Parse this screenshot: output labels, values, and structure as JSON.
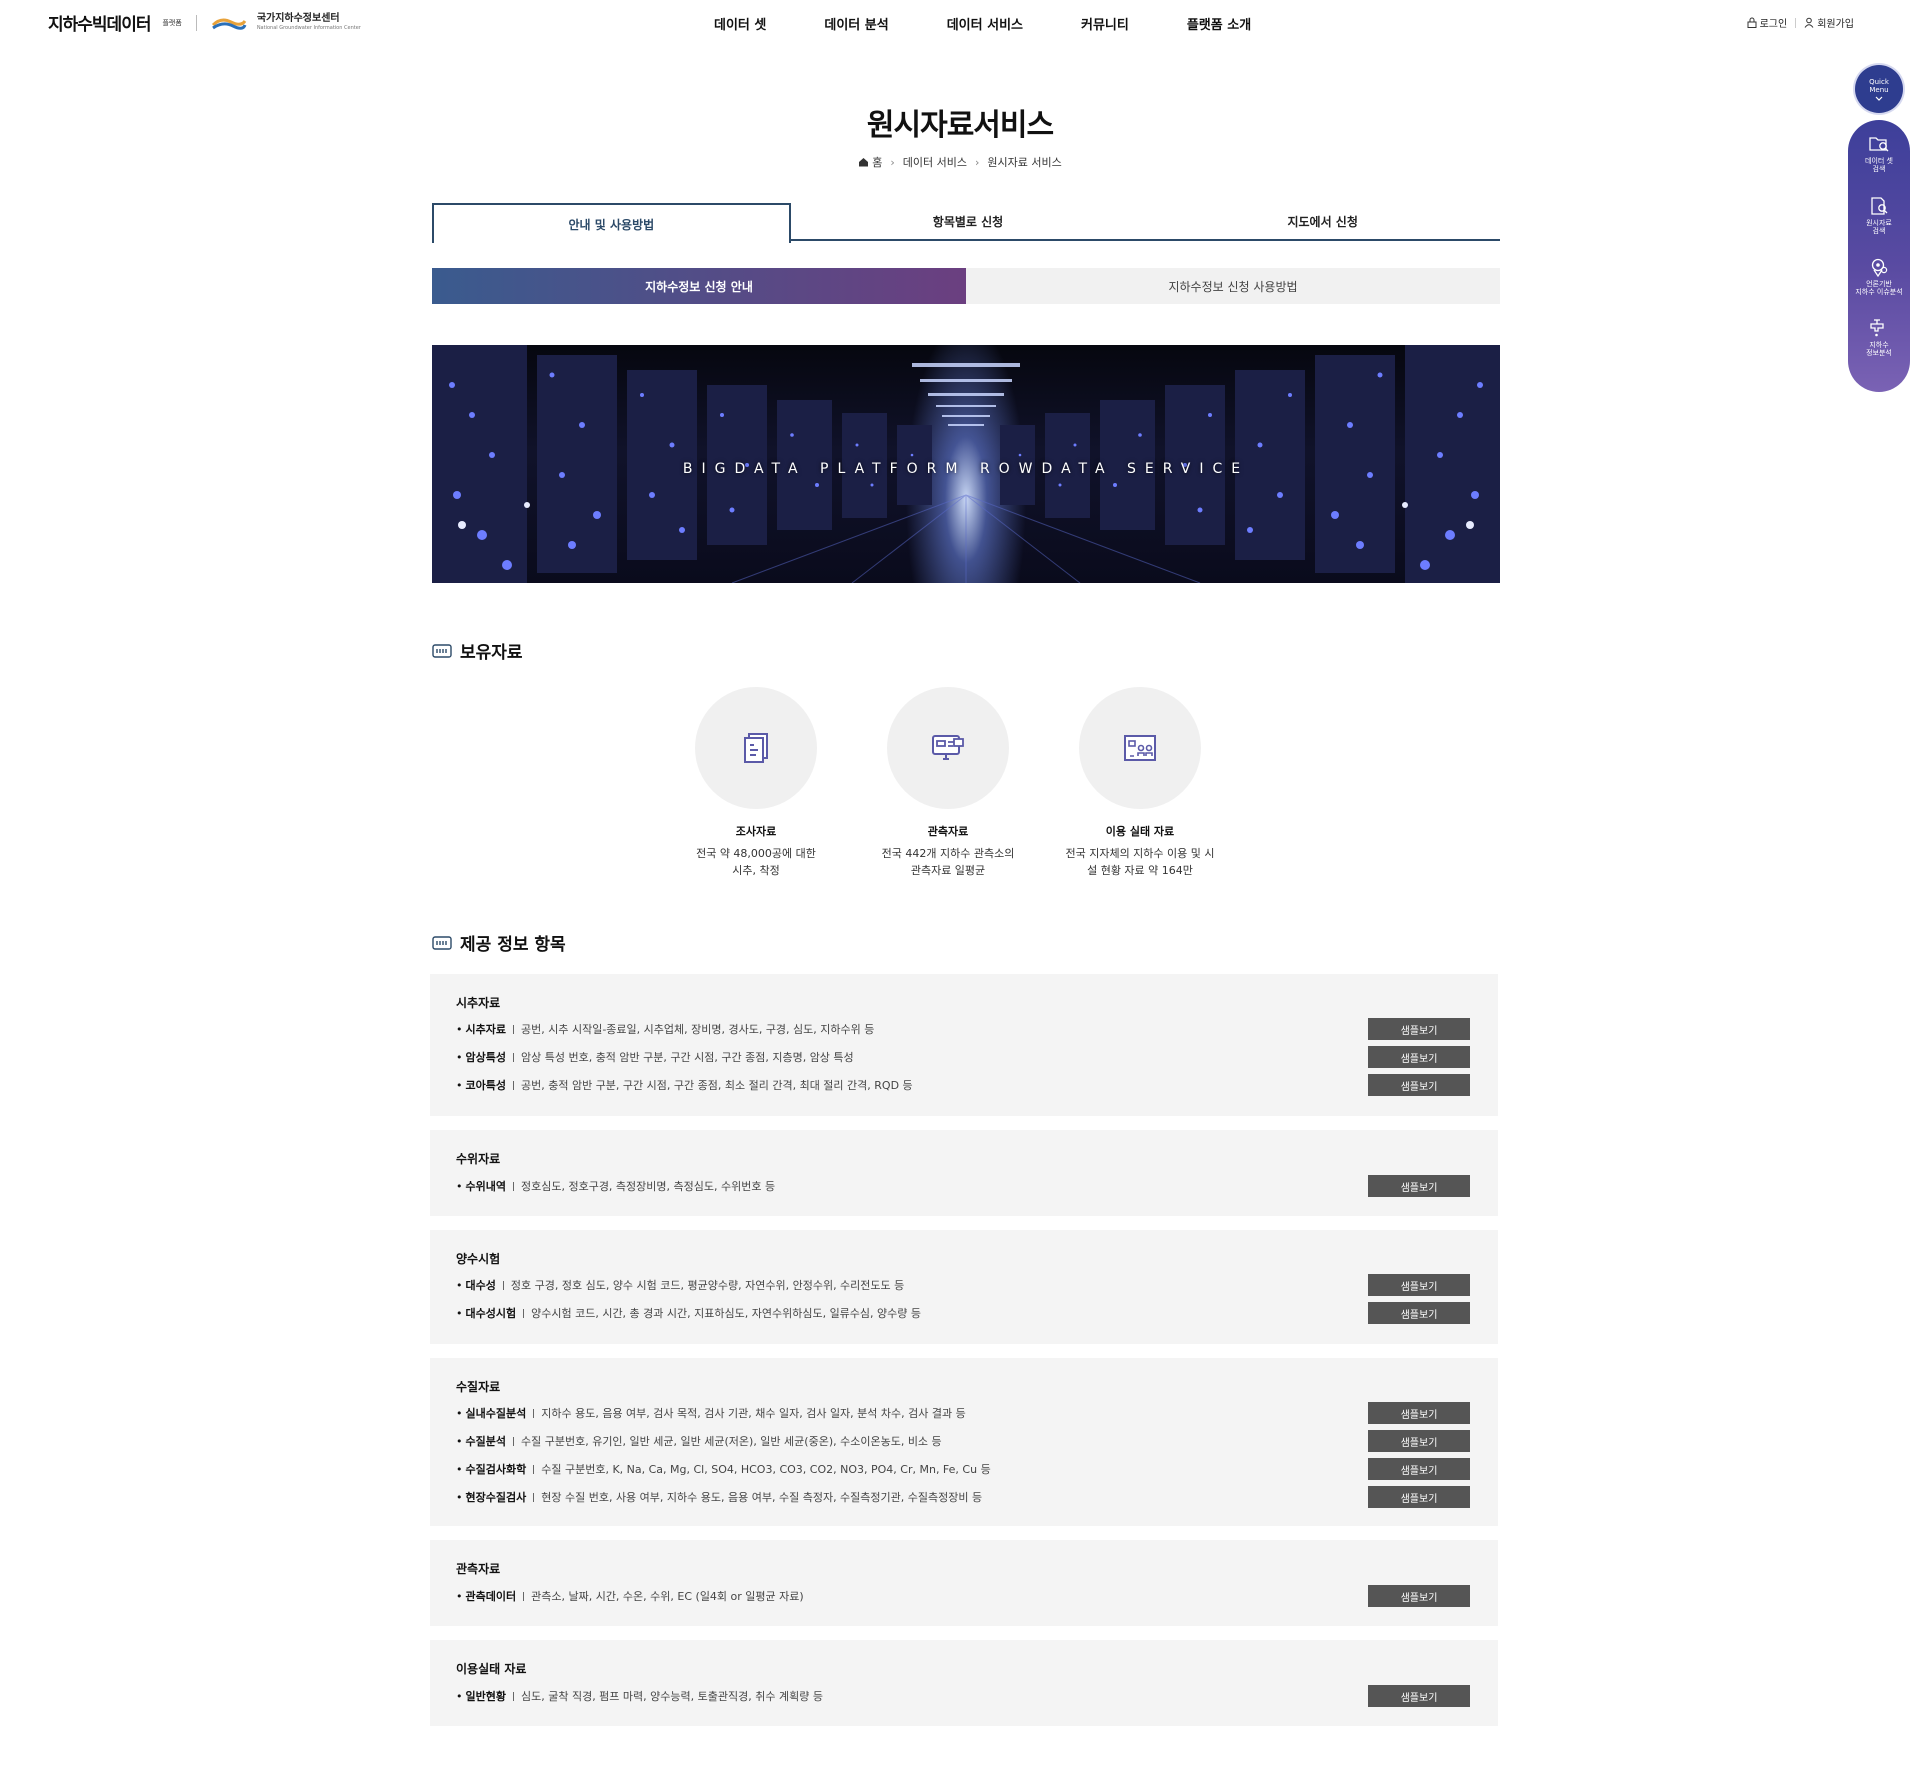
{
  "header": {
    "logo_main": "지하수빅데이터",
    "logo_sub": "플랫폼",
    "org_ko": "국가지하수정보센터",
    "org_en": "National Groundwater Information Center",
    "nav": [
      "데이터 셋",
      "데이터 분석",
      "데이터 서비스",
      "커뮤니티",
      "플랫폼 소개"
    ],
    "login": "로그인",
    "signup": "회원가입"
  },
  "quick_menu": {
    "title_line1": "Quick",
    "title_line2": "Menu",
    "items": [
      {
        "line1": "데이터 셋",
        "line2": "검색",
        "icon": "folder-search-icon"
      },
      {
        "line1": "원시자료",
        "line2": "검색",
        "icon": "document-search-icon"
      },
      {
        "line1": "언론기반",
        "line2": "지하수 이슈분석",
        "icon": "location-search-icon"
      },
      {
        "line1": "지하수",
        "line2": "정보분석",
        "icon": "faucet-icon"
      }
    ]
  },
  "page": {
    "title": "원시자료서비스",
    "breadcrumb": [
      "홈",
      "데이터 서비스",
      "원시자료 서비스"
    ]
  },
  "tabs": [
    "안내 및 사용방법",
    "항목별로 신청",
    "지도에서 신청"
  ],
  "subtabs": [
    "지하수정보 신청 안내",
    "지하수정보 신청 사용방법"
  ],
  "banner": {
    "text": "BIGDATA PLATFORM ROWDATA SERVICE"
  },
  "holdings": {
    "heading": "보유자료",
    "items": [
      {
        "title": "조사자료",
        "desc1": "전국 약 48,000공에 대한",
        "desc2": "시추, 착정",
        "icon": "document-stack-icon"
      },
      {
        "title": "관측자료",
        "desc1": "전국 442개 지하수 관측소의",
        "desc2": "관측자료 일평균",
        "icon": "monitor-icon"
      },
      {
        "title": "이용 실태 자료",
        "desc1": "전국 지자체의 지하수 이용 및 시",
        "desc2": "설 현황 자료 약 164만",
        "icon": "facility-board-icon"
      }
    ]
  },
  "provided": {
    "heading": "제공 정보 항목",
    "button_label": "샘플보기",
    "groups": [
      {
        "title": "시추자료",
        "rows": [
          {
            "name": "시추자료",
            "desc": "공번, 시추 시작일-종료일, 시추업체, 장비명, 경사도, 구경, 심도, 지하수위 등"
          },
          {
            "name": "암상특성",
            "desc": "암상 특성 번호, 충적 암반 구분, 구간 시점, 구간 종점, 지층명, 암상 특성"
          },
          {
            "name": "코아특성",
            "desc": "공번, 충적 암반 구분, 구간 시점, 구간 종점, 최소 절리 간격, 최대 절리 간격, RQD 등"
          }
        ]
      },
      {
        "title": "수위자료",
        "rows": [
          {
            "name": "수위내역",
            "desc": "정호심도, 정호구경, 측정장비명, 측정심도, 수위번호 등"
          }
        ]
      },
      {
        "title": "양수시험",
        "rows": [
          {
            "name": "대수성",
            "desc": "정호 구경, 정호 심도, 양수 시험 코드, 평균양수량, 자연수위, 안정수위, 수리전도도 등"
          },
          {
            "name": "대수성시험",
            "desc": "양수시험 코드, 시간, 총 경과 시간, 지표하심도, 자연수위하심도, 일류수심, 양수량 등"
          }
        ]
      },
      {
        "title": "수질자료",
        "rows": [
          {
            "name": "실내수질분석",
            "desc": "지하수 용도, 음용 여부, 검사 목적, 검사 기관, 채수 일자, 검사 일자, 분석 차수, 검사 결과 등"
          },
          {
            "name": "수질분석",
            "desc": "수질 구분번호, 유기인, 일반 세균, 일반 세균(저온), 일반 세균(중온), 수소이온농도, 비소 등"
          },
          {
            "name": "수질검사화학",
            "desc": "수질 구분번호, K, Na, Ca, Mg, Cl, SO4, HCO3, CO3, CO2, NO3, PO4, Cr, Mn, Fe, Cu 등"
          },
          {
            "name": "현장수질검사",
            "desc": "현장 수질 번호, 사용 여부, 지하수 용도, 음용 여부, 수질 측정자, 수질측정기관, 수질측정장비 등"
          }
        ]
      },
      {
        "title": "관측자료",
        "rows": [
          {
            "name": "관측데이터",
            "desc": "관측소, 날짜, 시간, 수온, 수위, EC (일4회 or 일평균 자료)"
          }
        ]
      },
      {
        "title": "이용실태 자료",
        "rows": [
          {
            "name": "일반현황",
            "desc": "심도, 굴착 직경, 펌프 마력, 양수능력, 토출관직경, 취수 계획량 등"
          }
        ]
      }
    ]
  },
  "colors": {
    "tab_border": "#2c4a68",
    "subtab_gradient_start": "#3a5b8e",
    "subtab_gradient_end": "#6b3f80",
    "button_bg": "#555555",
    "box_bg": "#f4f4f4",
    "quick_menu": "#4a459f"
  }
}
